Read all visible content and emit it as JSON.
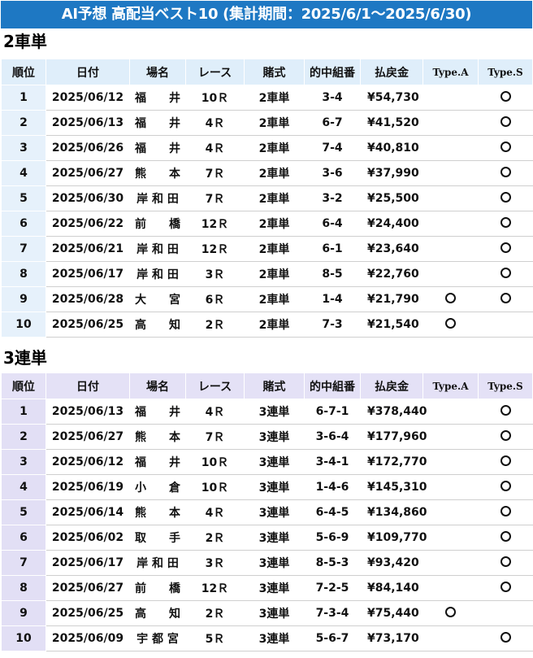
{
  "banner": "AI予想 高配当ベスト10 (集計期間：2025/6/1～2025/6/30)",
  "headers": {
    "rank": "順位",
    "date": "日付",
    "venue": "場名",
    "race": "レース",
    "bet": "賭式",
    "combo": "的中組番",
    "payout": "払戻金",
    "type_a": "Type.A",
    "type_s": "Type.S"
  },
  "sections": [
    {
      "title": "2車単",
      "rows": [
        {
          "rank": "1",
          "date": "2025/06/12",
          "venue": "福　　井",
          "race": "10Ｒ",
          "bet": "2車単",
          "combo": "3-4",
          "payout": "¥54,730",
          "type_a": false,
          "type_s": true
        },
        {
          "rank": "2",
          "date": "2025/06/13",
          "venue": "福　　井",
          "race": "4Ｒ",
          "bet": "2車単",
          "combo": "6-7",
          "payout": "¥41,520",
          "type_a": false,
          "type_s": true
        },
        {
          "rank": "3",
          "date": "2025/06/26",
          "venue": "福　　井",
          "race": "4Ｒ",
          "bet": "2車単",
          "combo": "7-4",
          "payout": "¥40,810",
          "type_a": false,
          "type_s": true
        },
        {
          "rank": "4",
          "date": "2025/06/27",
          "venue": "熊　　本",
          "race": "7Ｒ",
          "bet": "2車単",
          "combo": "3-6",
          "payout": "¥37,990",
          "type_a": false,
          "type_s": true
        },
        {
          "rank": "5",
          "date": "2025/06/30",
          "venue": "岸 和 田",
          "race": "7Ｒ",
          "bet": "2車単",
          "combo": "3-2",
          "payout": "¥25,500",
          "type_a": false,
          "type_s": true
        },
        {
          "rank": "6",
          "date": "2025/06/22",
          "venue": "前　　橋",
          "race": "12Ｒ",
          "bet": "2車単",
          "combo": "6-4",
          "payout": "¥24,400",
          "type_a": false,
          "type_s": true
        },
        {
          "rank": "7",
          "date": "2025/06/21",
          "venue": "岸 和 田",
          "race": "12Ｒ",
          "bet": "2車単",
          "combo": "6-1",
          "payout": "¥23,640",
          "type_a": false,
          "type_s": true
        },
        {
          "rank": "8",
          "date": "2025/06/17",
          "venue": "岸 和 田",
          "race": "3Ｒ",
          "bet": "2車単",
          "combo": "8-5",
          "payout": "¥22,760",
          "type_a": false,
          "type_s": true
        },
        {
          "rank": "9",
          "date": "2025/06/28",
          "venue": "大　　宮",
          "race": "6Ｒ",
          "bet": "2車単",
          "combo": "1-4",
          "payout": "¥21,790",
          "type_a": true,
          "type_s": true
        },
        {
          "rank": "10",
          "date": "2025/06/25",
          "venue": "高　　知",
          "race": "2Ｒ",
          "bet": "2車単",
          "combo": "7-3",
          "payout": "¥21,540",
          "type_a": true,
          "type_s": false
        }
      ]
    },
    {
      "title": "3連単",
      "rows": [
        {
          "rank": "1",
          "date": "2025/06/13",
          "venue": "福　　井",
          "race": "4Ｒ",
          "bet": "3連単",
          "combo": "6-7-1",
          "payout": "¥378,440",
          "type_a": false,
          "type_s": true
        },
        {
          "rank": "2",
          "date": "2025/06/27",
          "venue": "熊　　本",
          "race": "7Ｒ",
          "bet": "3連単",
          "combo": "3-6-4",
          "payout": "¥177,960",
          "type_a": false,
          "type_s": true
        },
        {
          "rank": "3",
          "date": "2025/06/12",
          "venue": "福　　井",
          "race": "10Ｒ",
          "bet": "3連単",
          "combo": "3-4-1",
          "payout": "¥172,770",
          "type_a": false,
          "type_s": true
        },
        {
          "rank": "4",
          "date": "2025/06/19",
          "venue": "小　　倉",
          "race": "10Ｒ",
          "bet": "3連単",
          "combo": "1-4-6",
          "payout": "¥145,310",
          "type_a": false,
          "type_s": true
        },
        {
          "rank": "5",
          "date": "2025/06/14",
          "venue": "熊　　本",
          "race": "4Ｒ",
          "bet": "3連単",
          "combo": "6-4-5",
          "payout": "¥134,860",
          "type_a": false,
          "type_s": true
        },
        {
          "rank": "6",
          "date": "2025/06/02",
          "venue": "取　　手",
          "race": "2Ｒ",
          "bet": "3連単",
          "combo": "5-6-9",
          "payout": "¥109,770",
          "type_a": false,
          "type_s": true
        },
        {
          "rank": "7",
          "date": "2025/06/17",
          "venue": "岸 和 田",
          "race": "3Ｒ",
          "bet": "3連単",
          "combo": "8-5-3",
          "payout": "¥93,420",
          "type_a": false,
          "type_s": true
        },
        {
          "rank": "8",
          "date": "2025/06/27",
          "venue": "前　　橋",
          "race": "12Ｒ",
          "bet": "3連単",
          "combo": "7-2-5",
          "payout": "¥84,140",
          "type_a": false,
          "type_s": true
        },
        {
          "rank": "9",
          "date": "2025/06/25",
          "venue": "高　　知",
          "race": "2Ｒ",
          "bet": "3連単",
          "combo": "7-3-4",
          "payout": "¥75,440",
          "type_a": true,
          "type_s": false
        },
        {
          "rank": "10",
          "date": "2025/06/09",
          "venue": "宇 都 宮",
          "race": "5Ｒ",
          "bet": "3連単",
          "combo": "5-6-7",
          "payout": "¥73,170",
          "type_a": false,
          "type_s": true
        }
      ]
    }
  ]
}
